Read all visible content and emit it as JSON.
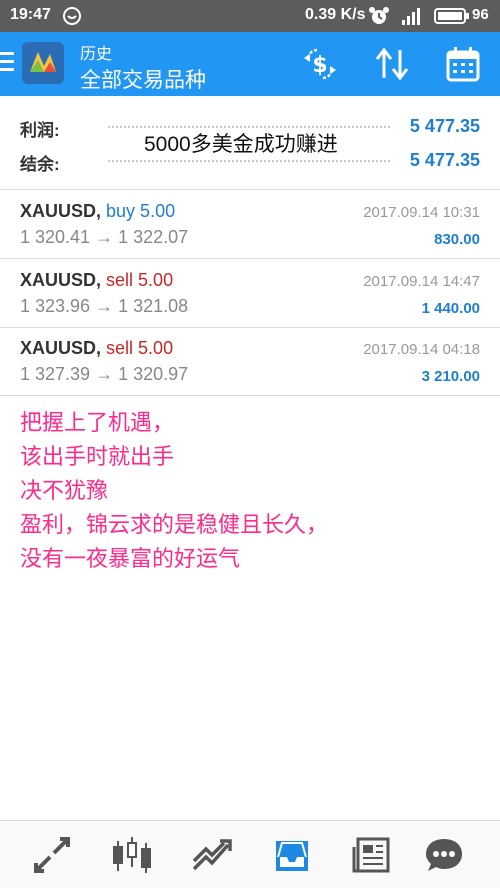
{
  "status": {
    "time": "19:47",
    "speed": "0.39 K/s",
    "battery": "96"
  },
  "header": {
    "subtitle": "历史",
    "title": "全部交易品种",
    "icons": [
      "currency-exchange-icon",
      "sort-icon",
      "calendar-icon"
    ]
  },
  "summary": {
    "profit_label": "利润:",
    "profit_value": "5 477.35",
    "balance_label": "结余:",
    "balance_value": "5 477.35",
    "overlay_text": "5000多美金成功赚进"
  },
  "trades": [
    {
      "symbol": "XAUUSD,",
      "side": "buy 5.00",
      "prices": "1 320.41 → 1 322.07",
      "date": "2017.09.14 10:31",
      "profit": "830.00"
    },
    {
      "symbol": "XAUUSD,",
      "side": "sell 5.00",
      "prices": "1 323.96 → 1 321.08",
      "date": "2017.09.14 14:47",
      "profit": "1 440.00"
    },
    {
      "symbol": "XAUUSD,",
      "side": "sell 5.00",
      "prices": "1 327.39 → 1 320.97",
      "date": "2017.09.14 04:18",
      "profit": "3 210.00"
    }
  ],
  "notes": [
    "把握上了机遇，",
    "该出手时就出手",
    "决不犹豫",
    "盈利，锦云求的是稳健且长久，",
    "没有一夜暴富的好运气"
  ],
  "bottom_nav": [
    "quotes-icon",
    "chart-icon",
    "trade-icon",
    "history-icon",
    "news-icon",
    "chat-icon"
  ],
  "colors": {
    "accent": "#2196f3",
    "profit": "#1e7fd0",
    "sell": "#c62828",
    "note": "#ff2a8a"
  }
}
